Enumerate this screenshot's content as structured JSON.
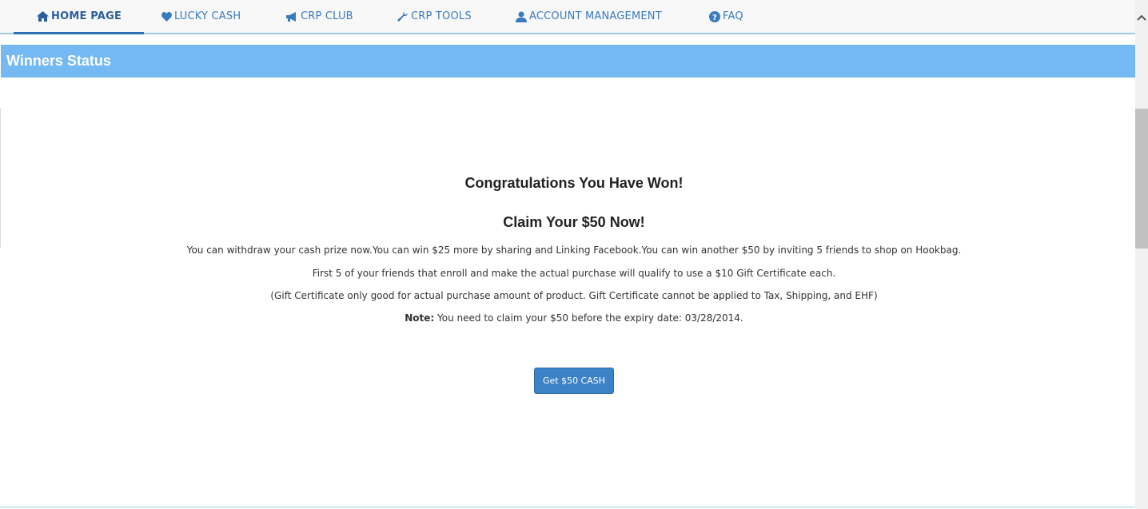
{
  "nav": {
    "items": [
      {
        "label": "HOME PAGE",
        "icon": "home-icon"
      },
      {
        "label": "LUCKY CASH",
        "icon": "heart-icon"
      },
      {
        "label": "CRP CLUB",
        "icon": "megaphone-icon"
      },
      {
        "label": "CRP TOOLS",
        "icon": "wrench-icon"
      },
      {
        "label": "ACCOUNT MANAGEMENT",
        "icon": "user-icon"
      },
      {
        "label": "FAQ",
        "icon": "question-circle-icon"
      }
    ],
    "active": "HOME PAGE"
  },
  "panel": {
    "title": "Winners Status"
  },
  "main": {
    "congrats": "Congratulations You Have Won!",
    "claim": "Claim Your $50 Now!",
    "line1": "You can withdraw your cash prize now.You can win $25 more by sharing and Linking Facebook.You can win another $50 by inviting 5 friends to shop on Hookbag.",
    "line2": "First 5 of your friends that enroll and make the actual purchase will qualify to use a $10 Gift Certificate each.",
    "line3": "(Gift Certificate only good for actual purchase amount of product. Gift Certificate cannot be applied to Tax, Shipping, and EHF)",
    "note_label": "Note:",
    "note_text": " You need to claim your $50 before the expiry date: 03/28/2014.",
    "button_label": "Get $50 CASH"
  },
  "colors": {
    "accent": "#74b9f2",
    "nav_text": "#3a7bbf",
    "button": "#3c82c6"
  }
}
